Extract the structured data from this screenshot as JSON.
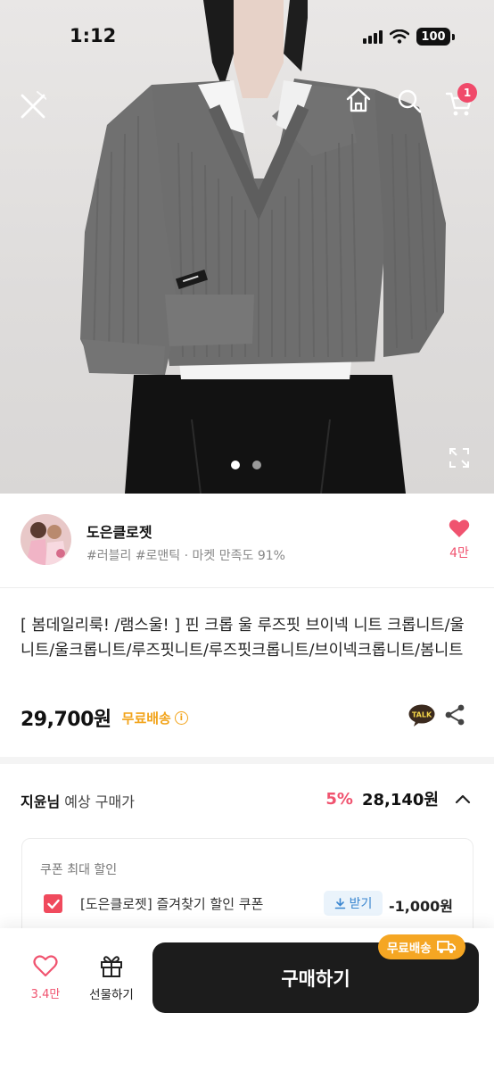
{
  "status_bar": {
    "time": "1:12",
    "battery": "100"
  },
  "top_nav": {
    "cart_count": "1"
  },
  "gallery": {
    "total": 2,
    "active_index": 0,
    "active_color": "#ffffff",
    "inactive_color": "#9a9a9a"
  },
  "shop": {
    "name": "도은클로젯",
    "subtitle": "#러블리 #로맨틱 · 마켓 만족도 91%",
    "likes": "4만"
  },
  "product": {
    "title": "[ 봄데일리룩! /램스울! ] 핀 크롭 울 루즈핏 브이넥 니트 크롭니트/울니트/울크롭니트/루즈핏니트/루즈핏크롭니트/브이넥크롭니트/봄니트",
    "price": "29,700원",
    "shipping_label": "무료배송",
    "talk_label": "TALK"
  },
  "estimate": {
    "user": "지윤님",
    "label": "예상 구매가",
    "discount": "5%",
    "price": "28,140원"
  },
  "coupon": {
    "title": "쿠폰 최대 할인",
    "name": "[도은클로젯] 즐겨찾기 할인 쿠폰",
    "download_label": "받기",
    "amount": "-1,000원",
    "checked": true
  },
  "bottom_bar": {
    "likes": "3.4만",
    "gift_label": "선물하기",
    "buy_label": "구매하기",
    "shipping_chip": "무료배송"
  },
  "colors": {
    "accent_pink": "#f0536f",
    "shipping_orange": "#f5a623",
    "buy_button": "#1c1c1c"
  },
  "icons": [
    "close-icon",
    "home-icon",
    "search-icon",
    "cart-icon",
    "expand-icon",
    "heart-icon",
    "info-icon",
    "kakaotalk-icon",
    "share-icon",
    "chevron-up-icon",
    "checkbox-icon",
    "download-icon",
    "gift-icon",
    "truck-icon"
  ]
}
